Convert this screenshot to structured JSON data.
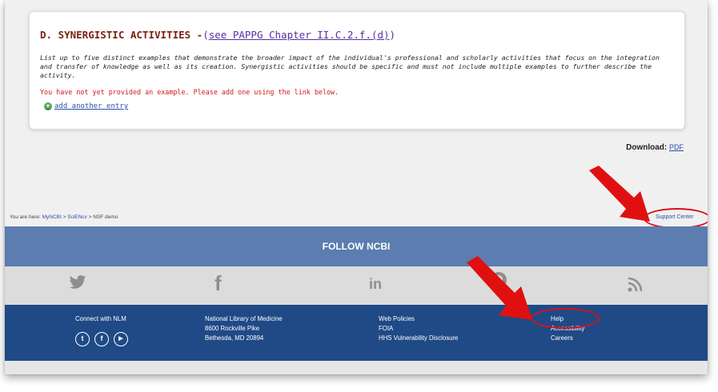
{
  "section": {
    "title": "D. SYNERGISTIC ACTIVITIES",
    "dash": " -",
    "open_paren": "(",
    "link_text": "see PAPPG Chapter II.C.2.f.(d)",
    "close_paren": ")",
    "description_line1": "List up to five distinct examples that demonstrate the broader impact of the individual's professional and scholarly activities that focus on the integration",
    "description_line2": "and transfer of knowledge as well as its creation. Synergistic activities should be specific and must not include multiple examples to further describe the",
    "description_line3": "activity.",
    "warning": "You have not yet provided an example. Please add one using the link below.",
    "add_entry": "add another entry",
    "add_icon": "+"
  },
  "download": {
    "label": "Download:",
    "pdf": "PDF"
  },
  "breadcrumb": {
    "prefix": "You are here: ",
    "items": [
      "MyNCBI",
      "SciENcv",
      "NSF demo"
    ],
    "sep": " > "
  },
  "support_center": "Support Center",
  "follow": {
    "title": "FOLLOW NCBI"
  },
  "social_icons": {
    "twitter": "🐦",
    "facebook": "f",
    "linkedin": "in",
    "github": "●",
    "rss": "὏"
  },
  "footer": {
    "connect_title": "Connect with NLM",
    "connect_icons": [
      "t",
      "f",
      "▶"
    ],
    "address": [
      "National Library of Medicine",
      "8600 Rockville Pike",
      "Bethesda, MD 20894"
    ],
    "policies": [
      "Web Policies",
      "FOIA",
      "HHS Vulnerability Disclosure"
    ],
    "help": [
      "Help",
      "Accessibility",
      "Careers"
    ]
  },
  "colors": {
    "arrow": "#e01010",
    "footer": "#1f4a86",
    "follow": "#5b7db0"
  }
}
